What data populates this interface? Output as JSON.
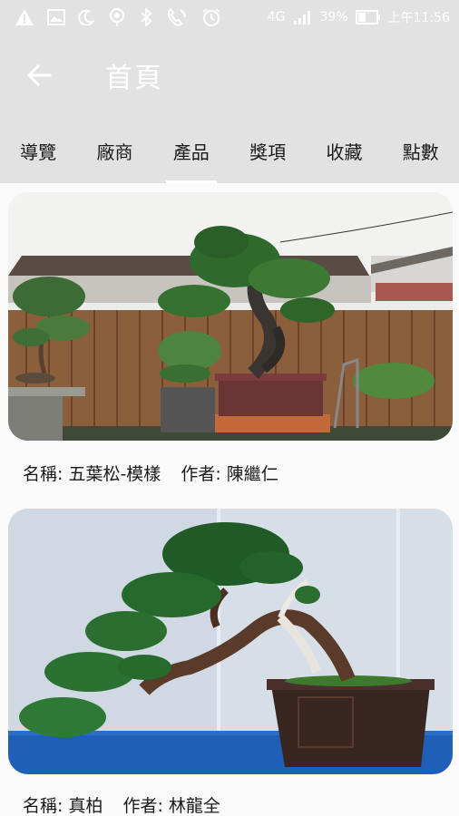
{
  "status_bar": {
    "battery": "39%",
    "network": "4G",
    "time": "上午11:56",
    "icons": [
      "warning-icon",
      "image-icon",
      "moon-icon",
      "location-icon",
      "bluetooth-icon",
      "phone-icon",
      "alarm-icon",
      "signal-icon",
      "battery-icon"
    ]
  },
  "app_bar": {
    "title": "首頁",
    "back_icon": "arrow-left-icon"
  },
  "tabs": [
    {
      "label": "導覽"
    },
    {
      "label": "廠商"
    },
    {
      "label": "產品",
      "active": true
    },
    {
      "label": "獎項"
    },
    {
      "label": "收藏"
    },
    {
      "label": "點數"
    }
  ],
  "products": [
    {
      "name_label": "名稱:",
      "name": "五葉松-模樣",
      "author_label": "作者:",
      "author": "陳繼仁"
    },
    {
      "name_label": "名稱:",
      "name": "真柏",
      "author_label": "作者:",
      "author": "林龍全"
    }
  ],
  "colors": {
    "bar": "#e2e2e2",
    "text": "#1a1a1a",
    "indicator": "#ffffff"
  }
}
